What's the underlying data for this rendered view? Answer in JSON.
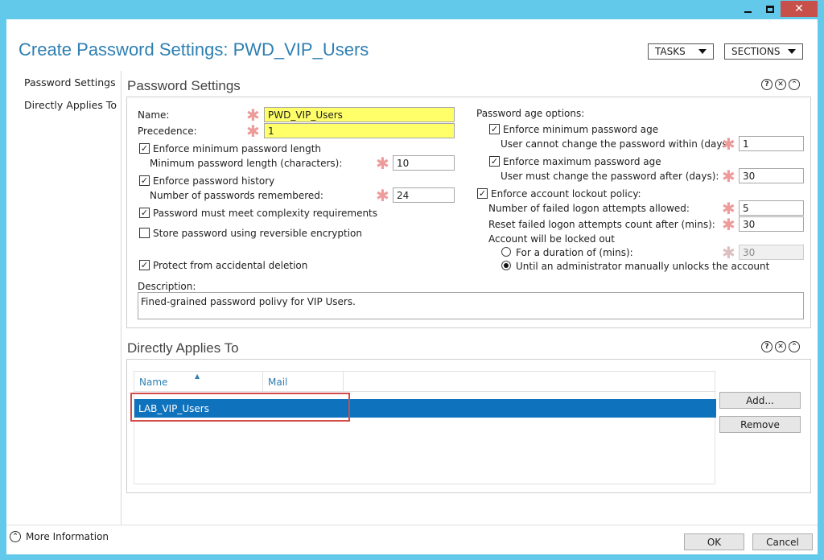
{
  "window": {
    "title": "Create Password Settings: PWD_VIP_Users",
    "controls": [
      "minimize-icon",
      "maximize-icon",
      "close-icon"
    ]
  },
  "header": {
    "tasks_label": "TASKS",
    "sections_label": "SECTIONS"
  },
  "nav": {
    "items": [
      {
        "label": "Password Settings"
      },
      {
        "label": "Directly Applies To"
      }
    ]
  },
  "password_settings": {
    "title": "Password Settings",
    "name_label": "Name:",
    "name_value": "PWD_VIP_Users",
    "precedence_label": "Precedence:",
    "precedence_value": "1",
    "enforce_min_length_label": "Enforce minimum password length",
    "enforce_min_length_checked": true,
    "min_length_label": "Minimum password length (characters):",
    "min_length_value": "10",
    "enforce_history_label": "Enforce password history",
    "enforce_history_checked": true,
    "history_label": "Number of passwords remembered:",
    "history_value": "24",
    "complexity_label": "Password must meet complexity requirements",
    "complexity_checked": true,
    "reversible_label": "Store password using reversible encryption",
    "reversible_checked": false,
    "protect_label": "Protect from accidental deletion",
    "protect_checked": true,
    "description_label": "Description:",
    "description_value": "Fined-grained password polivy for VIP Users.",
    "age_options_label": "Password age options:",
    "enforce_min_age_label": "Enforce minimum password age",
    "enforce_min_age_checked": true,
    "min_age_label": "User cannot change the password within (days):",
    "min_age_value": "1",
    "enforce_max_age_label": "Enforce maximum password age",
    "enforce_max_age_checked": true,
    "max_age_label": "User must change the password after (days):",
    "max_age_value": "30",
    "lockout_label": "Enforce account lockout policy:",
    "lockout_checked": true,
    "failed_attempts_label": "Number of failed logon attempts allowed:",
    "failed_attempts_value": "5",
    "reset_count_label": "Reset failed logon attempts count after (mins):",
    "reset_count_value": "30",
    "locked_out_label": "Account will be locked out",
    "duration_label": "For a duration of (mins):",
    "duration_value": "30",
    "duration_selected": false,
    "manual_unlock_label": "Until an administrator manually unlocks the account",
    "manual_unlock_selected": true
  },
  "applies_to": {
    "title": "Directly Applies To",
    "columns": [
      "Name",
      "Mail"
    ],
    "rows": [
      {
        "name": "LAB_VIP_Users",
        "mail": ""
      }
    ],
    "add_label": "Add...",
    "remove_label": "Remove"
  },
  "footer": {
    "more_info_label": "More Information",
    "ok_label": "OK",
    "cancel_label": "Cancel"
  },
  "colors": {
    "titlebar": "#62c9ea",
    "accent_text": "#2e7fb3",
    "selection": "#0f72bd",
    "required_highlight": "#ffff6a",
    "close_button": "#c7504a",
    "annotation_box": "#d34b4b"
  }
}
